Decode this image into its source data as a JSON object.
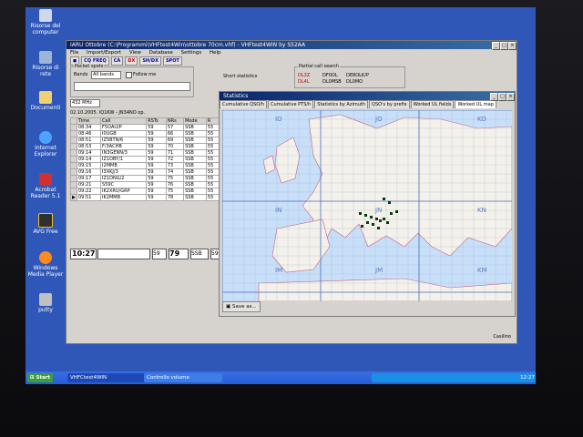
{
  "desktop_icons": [
    "Risorse del computer",
    "Risorse di rete",
    "Documenti",
    "Internet Explorer",
    "Acrobat Reader 5.1",
    "AVG Free",
    "Windows Media Player",
    "putty"
  ],
  "main_window": {
    "title": "IARU Ottobre (C:\\Programmi\\VHFtest4Win\\ottobre 70cm.vhf) - VHFtest4WIN by S52AA",
    "menu": [
      "File",
      "Import/Export",
      "View",
      "Database",
      "Settings",
      "Help"
    ],
    "toolbar": [
      "CQ FREQ",
      "CA",
      "DX",
      "SH/DX",
      "SPOT"
    ],
    "packet_spots_label": "Packet spots",
    "bands_label": "Bands",
    "bands_value": "All bands",
    "follow_me_label": "Follow me",
    "short_stats_label": "Short statistics",
    "partial_call_label": "Partial call search",
    "partial_calls": [
      "DL3Z",
      "DF0OL",
      "DE8OLK/P",
      "DL4L",
      "DL0MSB",
      "DL0MO"
    ],
    "band_select": "432 MHz",
    "date_line": "02.10.2005. IQ1KW - JN34NO op.",
    "log_headers": [
      "Time",
      "Call",
      "RSTs",
      "NRs",
      "Mode",
      "R"
    ],
    "log_rows": [
      [
        "08:34",
        "F5OAU/P",
        "59",
        "57",
        "SSB",
        "55"
      ],
      [
        "08:46",
        "I0UGB",
        "59",
        "66",
        "SSB",
        "55"
      ],
      [
        "08:51",
        "IZ5BTN/6",
        "59",
        "69",
        "SSB",
        "55"
      ],
      [
        "08:53",
        "F/3ACHB",
        "59",
        "70",
        "SSB",
        "55"
      ],
      [
        "09:14",
        "IN3GENN/3",
        "59",
        "71",
        "SSB",
        "55"
      ],
      [
        "09:14",
        "IZ1DBY/1",
        "59",
        "72",
        "SSB",
        "55"
      ],
      [
        "09:15",
        "I2MMB",
        "59",
        "73",
        "SSB",
        "55"
      ],
      [
        "09:16",
        "I3XKJ/3",
        "59",
        "74",
        "SSB",
        "55"
      ],
      [
        "09:17",
        "IZ1DNG/2",
        "59",
        "75",
        "SSB",
        "55"
      ],
      [
        "09:21",
        "S59C",
        "59",
        "76",
        "SSB",
        "55"
      ],
      [
        "09:22",
        "IK2XRU/GRP",
        "59",
        "75",
        "SSB",
        "55"
      ],
      [
        "09:51",
        "IK2MMB",
        "59",
        "78",
        "SSB",
        "55"
      ]
    ],
    "entry_time": "10:27",
    "entry_rst": "59",
    "entry_nr": "79",
    "entry_mode": "SSB",
    "entry_extra": "59",
    "status_user": "Casilino"
  },
  "stats_window": {
    "title": "Statistics",
    "tabs": [
      "Cumulative QSO/h",
      "Cumulative PTS/h",
      "Statistics by Azimuth",
      "QSO's by prefix",
      "Worked UL fields",
      "Worked UL map"
    ],
    "save_label": "Save as...",
    "grid_labels": [
      "IO",
      "JO",
      "KO",
      "IN",
      "JN",
      "KN",
      "IM",
      "JM",
      "KM"
    ],
    "map_colors": {
      "sea": "#c8dff8",
      "land": "#f4f1ea"
    }
  },
  "taskbar": {
    "start": "Start",
    "tasks": [
      "VHFCtest4WIN",
      "Controllo volume"
    ],
    "clock": "12:27"
  }
}
